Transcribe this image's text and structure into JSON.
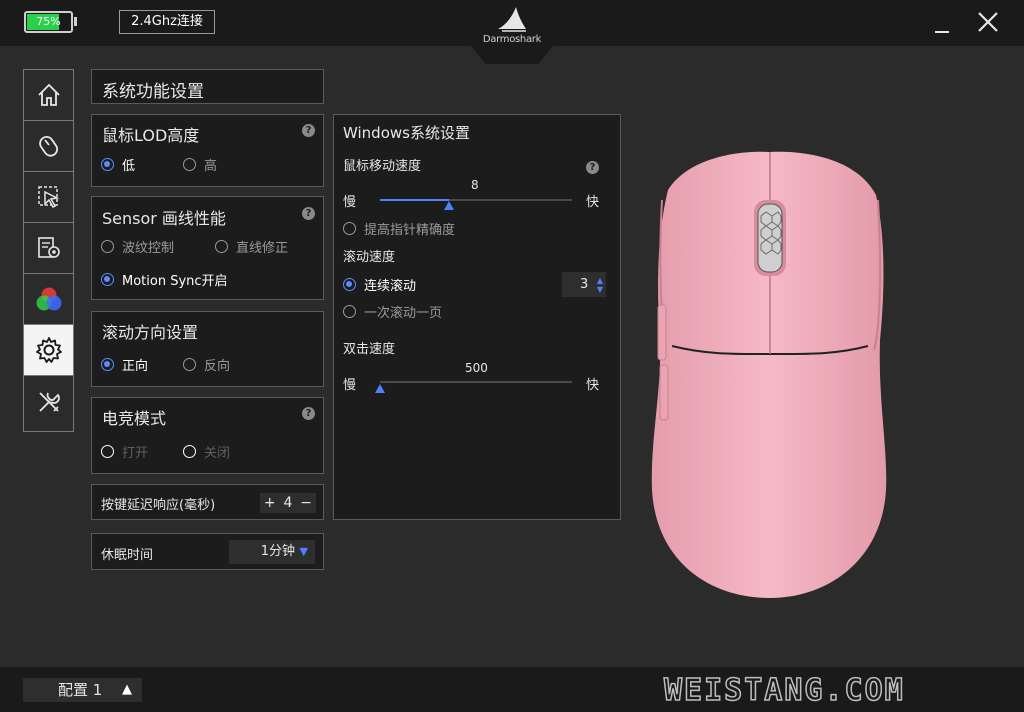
{
  "header": {
    "battery_percent": 75,
    "battery_label": "75%",
    "connection": "2.4Ghz连接",
    "brand": "Darmoshark"
  },
  "nav": {
    "items": [
      {
        "icon": "home-icon"
      },
      {
        "icon": "mouse-icon"
      },
      {
        "icon": "cursor-select-icon"
      },
      {
        "icon": "macro-settings-icon"
      },
      {
        "icon": "rgb-color-icon"
      },
      {
        "icon": "gear-icon",
        "active": true
      },
      {
        "icon": "tools-icon"
      }
    ]
  },
  "system": {
    "title": "系统功能设置",
    "lod": {
      "title": "鼠标LOD高度",
      "low": "低",
      "high": "高"
    },
    "sensor": {
      "title": "Sensor 画线性能",
      "ripple": "波纹控制",
      "straight": "直线修正",
      "motion_sync": "Motion Sync开启"
    },
    "scroll_dir": {
      "title": "滚动方向设置",
      "forward": "正向",
      "reverse": "反向"
    },
    "esports": {
      "title": "电竞模式",
      "on": "打开",
      "off": "关闭"
    },
    "debounce": {
      "label": "按键延迟响应(毫秒)",
      "plus": "+",
      "value": "4",
      "minus": "−"
    },
    "sleep": {
      "label": "休眠时间",
      "value": "1分钟"
    }
  },
  "windows": {
    "title": "Windows系统设置",
    "pointer_speed": {
      "label": "鼠标移动速度",
      "slow": "慢",
      "fast": "快",
      "value": "8",
      "level": 0.36
    },
    "precision": "提高指针精确度",
    "scroll_speed": {
      "label": "滚动速度",
      "continuous": "连续滚动",
      "lines": "3",
      "one_page": "一次滚动一页"
    },
    "double_click": {
      "label": "双击速度",
      "slow": "慢",
      "fast": "快",
      "value": "500",
      "level": 0.0
    }
  },
  "footer": {
    "profile": "配置 1",
    "watermark": "WEISTANG.COM"
  },
  "colors": {
    "accent": "#4f80ff",
    "battery": "#29d14a",
    "mouse_body": "#f4b3bf"
  }
}
